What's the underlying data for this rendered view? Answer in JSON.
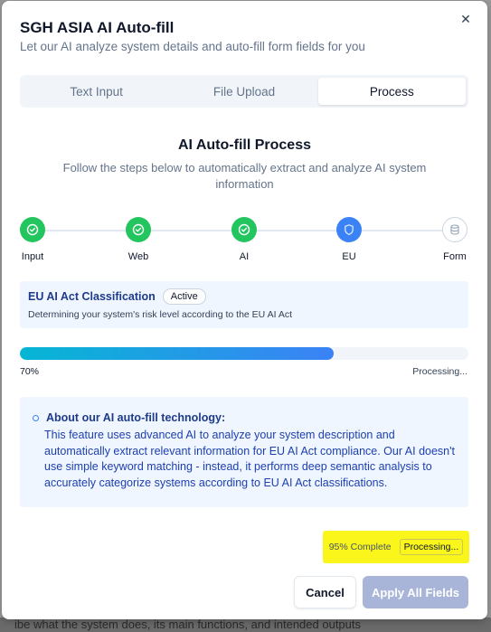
{
  "background": {
    "behind_text": "ibe what the system does, its main functions, and intended outputs"
  },
  "dialog": {
    "title": "SGH ASIA AI Auto-fill",
    "subtitle": "Let our AI analyze system details and auto-fill form fields for you",
    "close_label": "✕"
  },
  "tabs": [
    {
      "label": "Text Input",
      "active": false
    },
    {
      "label": "File Upload",
      "active": false
    },
    {
      "label": "Process",
      "active": true
    }
  ],
  "process": {
    "title": "AI Auto-fill Process",
    "description": "Follow the steps below to automatically extract and analyze AI system information"
  },
  "steps": [
    {
      "label": "Input",
      "state": "done",
      "icon": "check-icon"
    },
    {
      "label": "Web",
      "state": "done",
      "icon": "check-icon"
    },
    {
      "label": "AI",
      "state": "done",
      "icon": "check-icon"
    },
    {
      "label": "EU",
      "state": "current",
      "icon": "shield-icon"
    },
    {
      "label": "Form",
      "state": "pending",
      "icon": "database-icon"
    }
  ],
  "current_step": {
    "name": "EU AI Act Classification",
    "badge": "Active",
    "description": "Determining your system's risk level according to the EU AI Act"
  },
  "progress": {
    "percent": 70,
    "percent_label": "70%",
    "status": "Processing..."
  },
  "info": {
    "heading": "About our AI auto-fill technology:",
    "body": "This feature uses advanced AI to analyze your system description and automatically extract relevant information for EU AI Act compliance. Our AI doesn't use simple keyword matching - instead, it performs deep semantic analysis to accurately categorize systems according to EU AI Act classifications."
  },
  "completion": {
    "text": "95% Complete",
    "badge": "Processing..."
  },
  "buttons": {
    "cancel": "Cancel",
    "apply": "Apply All Fields"
  },
  "colors": {
    "done": "#22c55e",
    "current": "#3b82f6",
    "highlight": "#faf61c",
    "apply_disabled": "#a8b5d8"
  }
}
